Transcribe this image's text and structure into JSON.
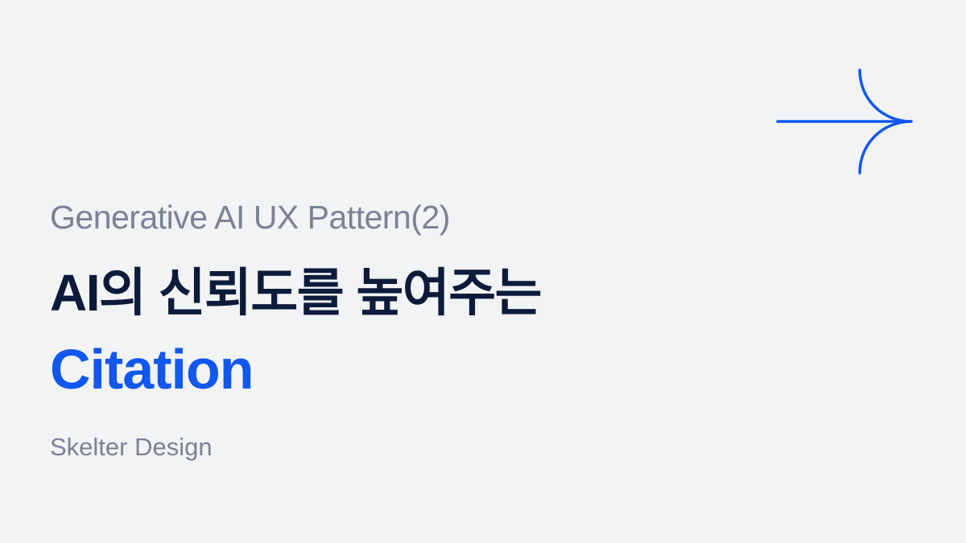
{
  "slide": {
    "subtitle": "Generative AI UX Pattern(2)",
    "headline": "AI의 신뢰도를 높여주는",
    "highlight": "Citation",
    "author": "Skelter Design"
  },
  "decor": {
    "arrow_icon": "arrow-right-icon"
  },
  "colors": {
    "background": "#f2f3f5",
    "accent": "#1157f0",
    "headline": "#0d1b3a",
    "muted": "#7a8294"
  }
}
